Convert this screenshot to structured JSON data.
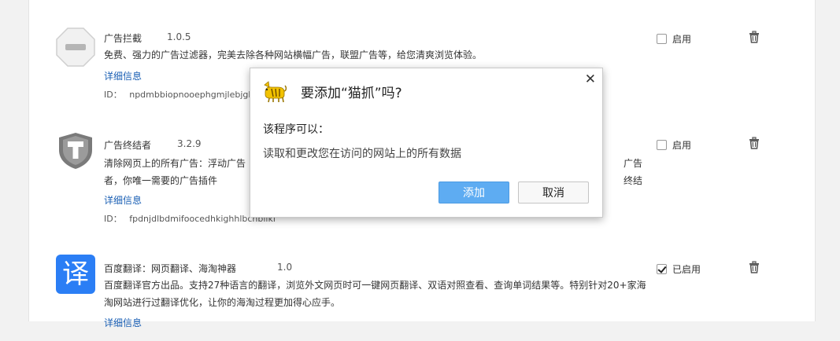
{
  "extensions": [
    {
      "name": "广告拦截",
      "version": "1.0.5",
      "description": "免费、强力的广告过滤器，完美去除各种网站横幅广告，联盟广告等，给您清爽浏览体验。",
      "details_link": "详细信息",
      "id_label": "ID：",
      "id_value": "npdmbbiopnooephgmjlebjgkl",
      "enable_label": "启用",
      "enabled": false
    },
    {
      "name": "广告终结者",
      "version": "3.2.9",
      "description_line1": "清除网页上的所有广告：浮动广告",
      "description_tail": "广告终结",
      "description_line2": "者，你唯一需要的广告插件",
      "details_link": "详细信息",
      "id_label": "ID：",
      "id_value": "fpdnjdlbdmifoocedhkighhlbchbiiki",
      "enable_label": "启用",
      "enabled": false
    },
    {
      "name": "百度翻译：网页翻译、海淘神器",
      "version": "1.0",
      "description": "百度翻译官方出品。支持27种语言的翻译，浏览外文网页时可一键网页翻译、双语对照查看、查询单词结果等。特别针对20+家海淘网站进行过翻译优化，让你的海淘过程更加得心应手。",
      "details_link": "详细信息",
      "enable_label": "已启用",
      "enabled": true,
      "icon_glyph": "译"
    }
  ],
  "dialog": {
    "title": "要添加“猫抓”吗?",
    "subtitle": "该程序可以：",
    "permission": "读取和更改您在访问的网站上的所有数据",
    "add_label": "添加",
    "cancel_label": "取消",
    "close_glyph": "✕"
  },
  "colors": {
    "accent": "#5eacf2",
    "link": "#1a5fb4",
    "baidu_blue": "#2b7ef5"
  }
}
